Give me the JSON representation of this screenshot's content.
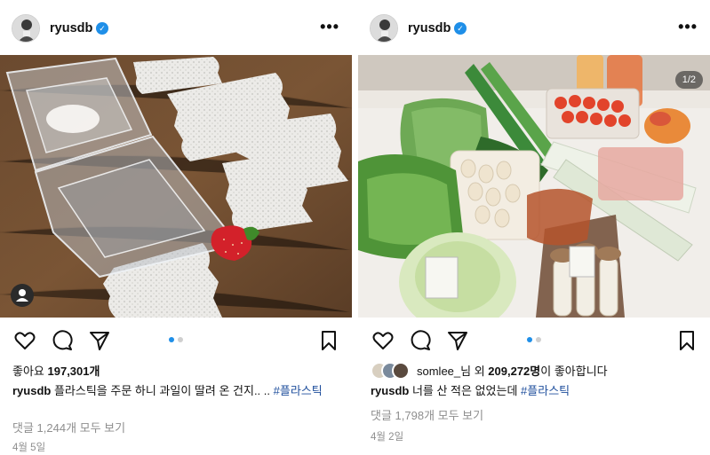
{
  "left_post": {
    "username": "ryusdb",
    "more": "•••",
    "likes_prefix": "좋아요 ",
    "likes_count": "197,301개",
    "caption_user": "ryusdb",
    "caption_text": " 플라스틱을 주문 하니 과일이 딸려 온 건지.. .. ",
    "caption_hashtag": "#플라스틱",
    "comments_link": "댓글 1,244개 모두 보기",
    "date": "4월 5일"
  },
  "right_post": {
    "username": "ryusdb",
    "more": "•••",
    "page_count": "1/2",
    "liker_name": "somlee_님",
    "likes_mid": " 외 ",
    "likes_count": "209,272명",
    "likes_suffix": "이 좋아합니다",
    "caption_user": "ryusdb",
    "caption_text": " 너를 산 적은 없었는데 ",
    "caption_hashtag": "#플라스틱",
    "comments_link": "댓글 1,798개 모두 보기",
    "date": "4월 2일"
  },
  "icons": [
    "heart-icon",
    "comment-icon",
    "share-icon",
    "bookmark-icon",
    "verified-icon",
    "more-icon",
    "user-tag-icon"
  ],
  "colors": {
    "verified": "#1f8fe8",
    "hashtag": "#1e4e9c",
    "muted": "#8e8e8e",
    "carousel_active": "#1f8fe8"
  }
}
